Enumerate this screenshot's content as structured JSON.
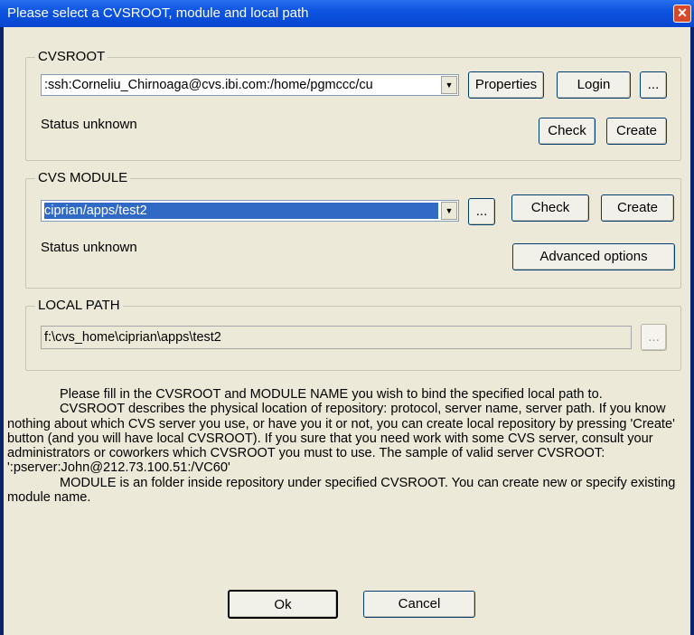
{
  "window": {
    "title": "Please select a CVSROOT, module and local path",
    "close_label": "✕"
  },
  "cvsroot": {
    "group_label": "CVSROOT",
    "value": ":ssh:Corneliu_Chirnoaga@cvs.ibi.com:/home/pgmccc/cu",
    "properties_label": "Properties",
    "login_label": "Login",
    "browse_label": "...",
    "status": "Status unknown",
    "check_label": "Check",
    "create_label": "Create"
  },
  "module": {
    "group_label": "CVS MODULE",
    "value": "ciprian/apps/test2",
    "browse_label": "...",
    "check_label": "Check",
    "create_label": "Create",
    "status": "Status unknown",
    "advanced_label": "Advanced options"
  },
  "local_path": {
    "group_label": "LOCAL PATH",
    "value": "f:\\cvs_home\\ciprian\\apps\\test2",
    "browse_label": "..."
  },
  "help": {
    "p1": "Please fill in the CVSROOT and MODULE NAME you wish to bind the specified local path to.",
    "p2": "CVSROOT describes the physical location of repository: protocol, server name, server path. If you know nothing about which CVS server you use, or have you it or not, you can create local repository by pressing 'Create' button (and you will have local CVSROOT). If you sure that you need work with some CVS server, consult your administrators or coworkers which CVSROOT you must to use. The sample of valid server CVSROOT: ':pserver:John@212.73.100.51:/VC60'",
    "p3": "MODULE is an folder inside repository under specified CVSROOT. You can create new or specify existing module name."
  },
  "footer": {
    "ok_label": "Ok",
    "cancel_label": "Cancel"
  },
  "icons": {
    "dropdown": "▼"
  }
}
